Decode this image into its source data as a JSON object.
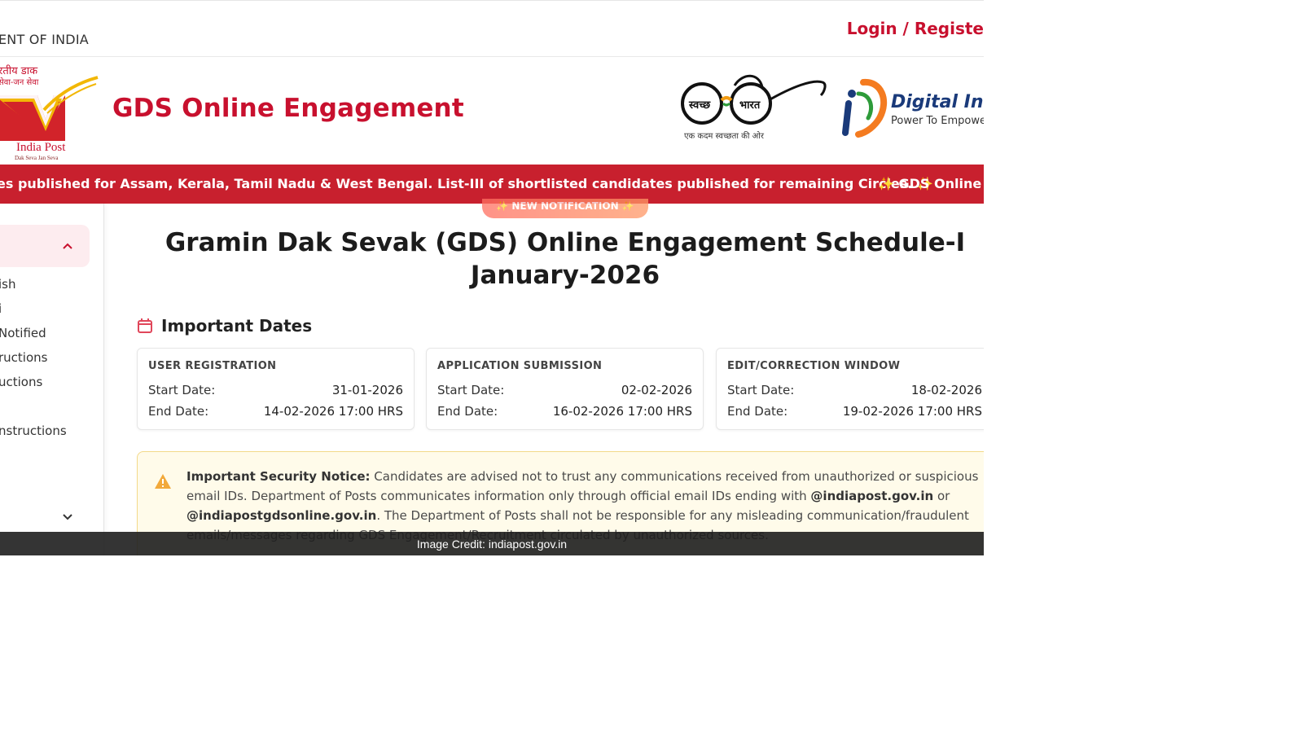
{
  "topbar": {
    "gov_label": "ENT OF INDIA",
    "login_label": "Login / Registe"
  },
  "header": {
    "logo_hindi_1": "रतीय डाक",
    "logo_hindi_2": "सेवा-जन सेवा",
    "logo_word": "India Post",
    "logo_tagline": "Dak Seva Jan Seva",
    "site_title": "GDS Online Engagement",
    "swachh_left": "स्वच्छ",
    "swachh_right": "भारत",
    "swachh_caption": "एक कदम स्वच्छता की ओर",
    "digital_india_title": "Digital Indi",
    "digital_india_sub": "Power To Empowe"
  },
  "ticker": {
    "text_main": "es published for Assam, Kerala, Tamil Nadu & West Bengal. List-III of shortlisted candidates published for remaining Circles.",
    "text_next": "GDS Online E",
    "spark": "✨"
  },
  "sidebar": {
    "items": [
      "ish",
      "i",
      "Notified",
      "ructions",
      "uctions",
      "nstructions"
    ]
  },
  "notification_pill": "✨ NEW NOTIFICATION ✨",
  "page_title_line1": "Gramin Dak Sevak (GDS) Online Engagement Schedule-I",
  "page_title_line2": "January-2026",
  "important_dates": {
    "title": "Important Dates",
    "cards": [
      {
        "heading": "USER REGISTRATION",
        "start_label": "Start Date:",
        "start": "31-01-2026",
        "end_label": "End Date:",
        "end": "14-02-2026 17:00 HRS"
      },
      {
        "heading": "APPLICATION SUBMISSION",
        "start_label": "Start Date:",
        "start": "02-02-2026",
        "end_label": "End Date:",
        "end": "16-02-2026 17:00 HRS"
      },
      {
        "heading": "EDIT/CORRECTION WINDOW",
        "start_label": "Start Date:",
        "start": "18-02-2026",
        "end_label": "End Date:",
        "end": "19-02-2026 17:00 HRS"
      }
    ]
  },
  "notice": {
    "label": "Important Security Notice:",
    "text1": " Candidates are advised not to trust any communications received from unauthorized or suspicious email IDs. Department of Posts communicates information only through official email IDs ending with ",
    "email1": "@indiapost.gov.in",
    "text2": " or ",
    "email2": "@indiapostgdsonline.gov.in",
    "text3": ". The Department of Posts shall not be responsible for any misleading communication/fraudulent emails/messages regarding GDS Engagement/Recruitment circulated by unauthorized sources."
  },
  "credit": "Image Credit: indiapost.gov.in",
  "colors": {
    "brand_red": "#c8102e",
    "ticker_red": "#c8202e",
    "notice_bg": "#fffbea",
    "digital_india_blue": "#1a3a7a"
  }
}
